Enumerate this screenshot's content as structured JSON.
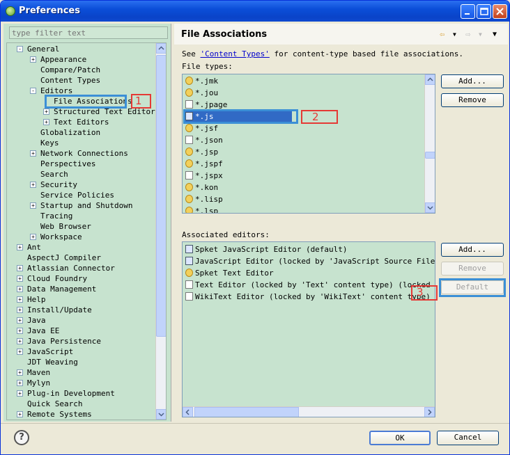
{
  "window": {
    "title": "Preferences"
  },
  "filter": {
    "placeholder": "type filter text"
  },
  "tree": [
    {
      "label": "General",
      "depth": 0,
      "expander": "-"
    },
    {
      "label": "Appearance",
      "depth": 1,
      "expander": "+"
    },
    {
      "label": "Compare/Patch",
      "depth": 1,
      "expander": ""
    },
    {
      "label": "Content Types",
      "depth": 1,
      "expander": ""
    },
    {
      "label": "Editors",
      "depth": 1,
      "expander": "-"
    },
    {
      "label": "File Associations",
      "depth": 2,
      "expander": ""
    },
    {
      "label": "Structured Text Editors",
      "depth": 2,
      "expander": "+"
    },
    {
      "label": "Text Editors",
      "depth": 2,
      "expander": "+"
    },
    {
      "label": "Globalization",
      "depth": 1,
      "expander": ""
    },
    {
      "label": "Keys",
      "depth": 1,
      "expander": ""
    },
    {
      "label": "Network Connections",
      "depth": 1,
      "expander": "+"
    },
    {
      "label": "Perspectives",
      "depth": 1,
      "expander": ""
    },
    {
      "label": "Search",
      "depth": 1,
      "expander": ""
    },
    {
      "label": "Security",
      "depth": 1,
      "expander": "+"
    },
    {
      "label": "Service Policies",
      "depth": 1,
      "expander": ""
    },
    {
      "label": "Startup and Shutdown",
      "depth": 1,
      "expander": "+"
    },
    {
      "label": "Tracing",
      "depth": 1,
      "expander": ""
    },
    {
      "label": "Web Browser",
      "depth": 1,
      "expander": ""
    },
    {
      "label": "Workspace",
      "depth": 1,
      "expander": "+"
    },
    {
      "label": "Ant",
      "depth": 0,
      "expander": "+"
    },
    {
      "label": "AspectJ Compiler",
      "depth": 0,
      "expander": ""
    },
    {
      "label": "Atlassian Connector",
      "depth": 0,
      "expander": "+"
    },
    {
      "label": "Cloud Foundry",
      "depth": 0,
      "expander": "+"
    },
    {
      "label": "Data Management",
      "depth": 0,
      "expander": "+"
    },
    {
      "label": "Help",
      "depth": 0,
      "expander": "+"
    },
    {
      "label": "Install/Update",
      "depth": 0,
      "expander": "+"
    },
    {
      "label": "Java",
      "depth": 0,
      "expander": "+"
    },
    {
      "label": "Java EE",
      "depth": 0,
      "expander": "+"
    },
    {
      "label": "Java Persistence",
      "depth": 0,
      "expander": "+"
    },
    {
      "label": "JavaScript",
      "depth": 0,
      "expander": "+"
    },
    {
      "label": "JDT Weaving",
      "depth": 0,
      "expander": ""
    },
    {
      "label": "Maven",
      "depth": 0,
      "expander": "+"
    },
    {
      "label": "Mylyn",
      "depth": 0,
      "expander": "+"
    },
    {
      "label": "Plug-in Development",
      "depth": 0,
      "expander": "+"
    },
    {
      "label": "Quick Search",
      "depth": 0,
      "expander": ""
    },
    {
      "label": "Remote Systems",
      "depth": 0,
      "expander": "+"
    }
  ],
  "annotations": {
    "one": "1",
    "two": "2",
    "three": "3"
  },
  "page": {
    "title": "File Associations",
    "see_prefix": "See ",
    "see_link": "'Content Types'",
    "see_suffix": " for content-type based file associations.",
    "file_types_label": "File types:",
    "assoc_label": "Associated editors:"
  },
  "file_types": [
    {
      "name": "*.jmk",
      "icon": "gear"
    },
    {
      "name": "*.jou",
      "icon": "gear"
    },
    {
      "name": "*.jpage",
      "icon": "json"
    },
    {
      "name": "*.js",
      "icon": "js",
      "selected": true
    },
    {
      "name": "*.jsf",
      "icon": "gear"
    },
    {
      "name": "*.json",
      "icon": "json"
    },
    {
      "name": "*.jsp",
      "icon": "gear"
    },
    {
      "name": "*.jspf",
      "icon": "gear"
    },
    {
      "name": "*.jspx",
      "icon": "file"
    },
    {
      "name": "*.kon",
      "icon": "gear"
    },
    {
      "name": "*.lisp",
      "icon": "gear"
    },
    {
      "name": "*.lsp",
      "icon": "gear"
    }
  ],
  "editors": [
    {
      "name": "Spket JavaScript Editor (default)",
      "icon": "js"
    },
    {
      "name": "JavaScript Editor (locked by 'JavaScript Source File' cor",
      "icon": "js"
    },
    {
      "name": "Spket Text Editor",
      "icon": "gear"
    },
    {
      "name": "Text Editor (locked by 'Text' content type) (locked by 'J",
      "icon": "file"
    },
    {
      "name": "WikiText Editor (locked by 'WikiText' content type)",
      "icon": "file"
    }
  ],
  "buttons": {
    "add_types": "Add...",
    "remove_types": "Remove",
    "add_editor": "Add...",
    "remove_editor": "Remove",
    "default_editor": "Default",
    "ok": "OK",
    "cancel": "Cancel",
    "help": "?"
  },
  "colors": {
    "tree_bg": "#c7e3cf",
    "selection": "#316ac5",
    "highlight_blue": "#3b8fd6",
    "highlight_red": "#e53935"
  }
}
